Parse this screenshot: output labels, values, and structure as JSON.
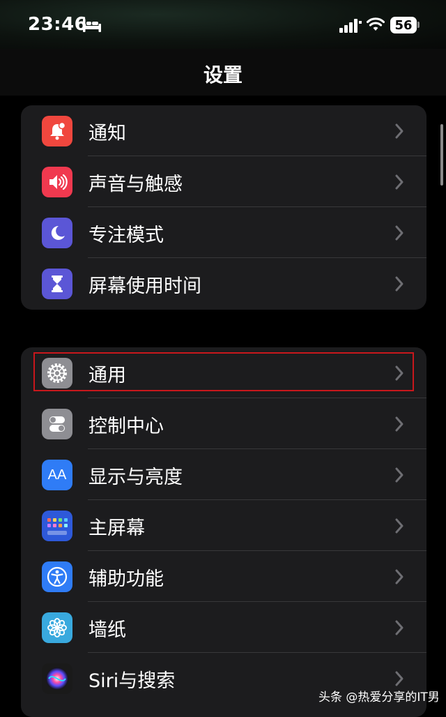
{
  "status_bar": {
    "time": "23:46",
    "battery": "56",
    "icons": [
      "sleep-bed-icon",
      "cellular-signal-icon",
      "wifi-icon",
      "battery-icon"
    ]
  },
  "nav": {
    "title": "设置"
  },
  "groups": [
    {
      "items": [
        {
          "label": "通知",
          "icon": "notifications-icon",
          "color": "#f0473e"
        },
        {
          "label": "声音与触感",
          "icon": "sounds-haptics-icon",
          "color": "#f0394f"
        },
        {
          "label": "专注模式",
          "icon": "focus-moon-icon",
          "color": "#5b56d6"
        },
        {
          "label": "屏幕使用时间",
          "icon": "screen-time-hourglass-icon",
          "color": "#5b56d6"
        }
      ]
    },
    {
      "items": [
        {
          "label": "通用",
          "icon": "general-gear-icon",
          "color": "#8e8e93",
          "highlighted": true
        },
        {
          "label": "控制中心",
          "icon": "control-center-toggles-icon",
          "color": "#8e8e93"
        },
        {
          "label": "显示与亮度",
          "icon": "display-brightness-aa-icon",
          "color": "#2f7cf6"
        },
        {
          "label": "主屏幕",
          "icon": "home-screen-grid-icon",
          "color": "#2e59d9"
        },
        {
          "label": "辅助功能",
          "icon": "accessibility-icon",
          "color": "#2f7cf6"
        },
        {
          "label": "墙纸",
          "icon": "wallpaper-flower-icon",
          "color": "#39a9de"
        },
        {
          "label": "Siri与搜索",
          "icon": "siri-icon",
          "color": "#222222"
        }
      ]
    }
  ],
  "icon_text": {
    "display_aa": "AA"
  },
  "highlight_color": "#c8171c",
  "watermark": "头条 @热爱分享的IT男"
}
